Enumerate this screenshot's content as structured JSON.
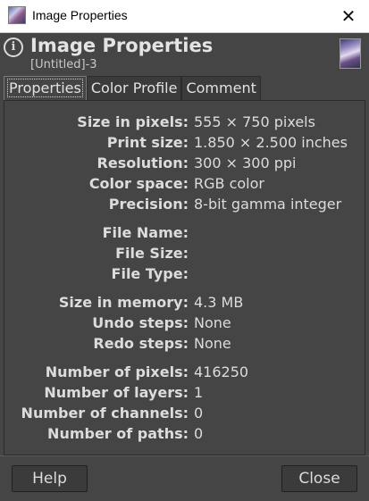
{
  "window": {
    "title": "Image Properties"
  },
  "header": {
    "title": "Image Properties",
    "subtitle": "[Untitled]-3"
  },
  "tabs": [
    {
      "label": "Properties",
      "active": true
    },
    {
      "label": "Color Profile",
      "active": false
    },
    {
      "label": "Comment",
      "active": false
    }
  ],
  "properties": [
    {
      "label": "Size in pixels:",
      "value": "555 × 750 pixels"
    },
    {
      "label": "Print size:",
      "value": "1.850 × 2.500 inches"
    },
    {
      "label": "Resolution:",
      "value": "300 × 300 ppi"
    },
    {
      "label": "Color space:",
      "value": "RGB color"
    },
    {
      "label": "Precision:",
      "value": "8-bit gamma integer"
    },
    {
      "label": "File Name:",
      "value": ""
    },
    {
      "label": "File Size:",
      "value": ""
    },
    {
      "label": "File Type:",
      "value": ""
    },
    {
      "label": "Size in memory:",
      "value": "4.3 MB"
    },
    {
      "label": "Undo steps:",
      "value": "None"
    },
    {
      "label": "Redo steps:",
      "value": "None"
    },
    {
      "label": "Number of pixels:",
      "value": "416250"
    },
    {
      "label": "Number of layers:",
      "value": "1"
    },
    {
      "label": "Number of channels:",
      "value": "0"
    },
    {
      "label": "Number of paths:",
      "value": "0"
    }
  ],
  "buttons": {
    "help": "Help",
    "close": "Close"
  }
}
